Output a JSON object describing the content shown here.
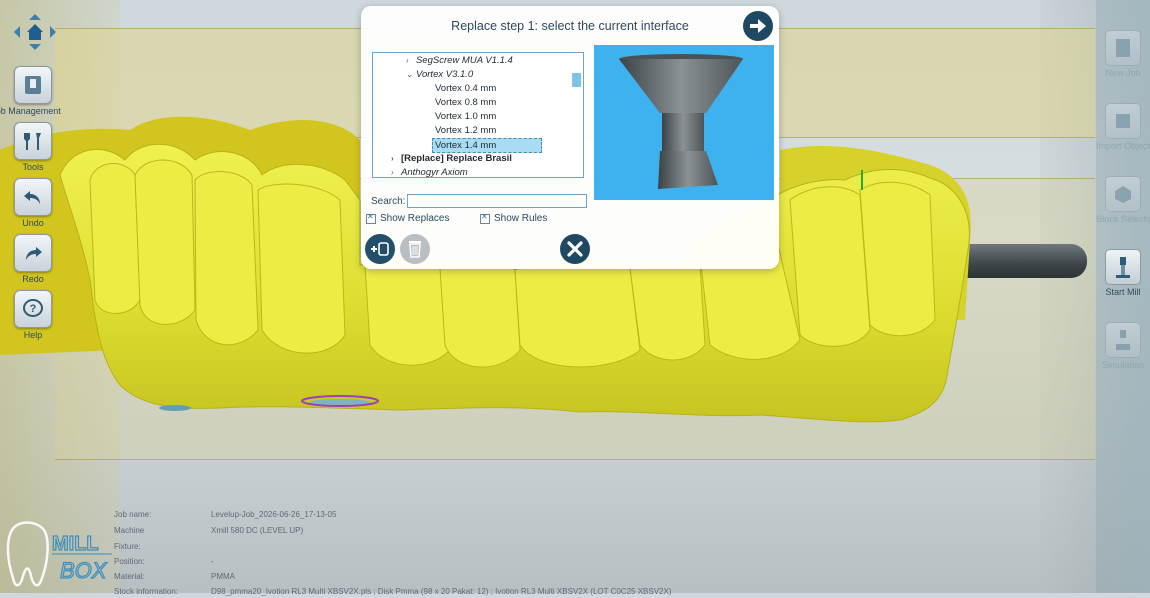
{
  "left_toolbar": {
    "items": [
      {
        "label": "Job Management",
        "icon": "folder-icon"
      },
      {
        "label": "Tools",
        "icon": "wrench-icon"
      },
      {
        "label": "Undo",
        "icon": "undo-icon"
      },
      {
        "label": "Redo",
        "icon": "redo-icon"
      },
      {
        "label": "Help",
        "icon": "help-icon"
      }
    ]
  },
  "right_toolbar": {
    "items": [
      {
        "label": "New Job",
        "icon": "new-job-icon"
      },
      {
        "label": "Import Object",
        "icon": "import-icon"
      },
      {
        "label": "Stock Selection",
        "icon": "stock-icon"
      },
      {
        "label": "Start Mill",
        "icon": "mill-icon"
      },
      {
        "label": "Simulation",
        "icon": "simulation-icon"
      }
    ]
  },
  "dialog": {
    "title": "Replace step 1: select the current interface",
    "tree": [
      {
        "label": "SegScrew MUA V1.1.4"
      },
      {
        "label": "Vortex V3.1.0"
      },
      {
        "label": "Vortex 0.4 mm"
      },
      {
        "label": "Vortex 0.8 mm"
      },
      {
        "label": "Vortex 1.0 mm"
      },
      {
        "label": "Vortex 1.2 mm"
      },
      {
        "label": "Vortex 1.4 mm"
      },
      {
        "label": "[Replace] Replace Brasil"
      },
      {
        "label": "Anthogyr Axiom"
      }
    ],
    "search_label": "Search:",
    "search_value": "",
    "show_replaces": "Show Replaces",
    "show_rules": "Show Rules"
  },
  "job_info": {
    "rows": [
      {
        "key": "Job name:",
        "value": "Levelup-Job_2026-06-26_17-13-05"
      },
      {
        "key": "Machine",
        "value": "Xmill 580 DC (LEVEL UP)"
      },
      {
        "key": "Fixture:",
        "value": ""
      },
      {
        "key": "Position:",
        "value": "-"
      },
      {
        "key": "Material:",
        "value": "PMMA"
      },
      {
        "key": "Stock information:",
        "value": "D98_pmma20_Ivotion RL3 Multi XBSV2X.pls ; Disk Pmma (98 x 20 Pakat: 12) ; Ivotion RL3 Multi XBSV2X (LOT C0C25 XBSV2X)"
      }
    ]
  },
  "logo": {
    "line1": "MILL",
    "line2": "BOX"
  },
  "colors": {
    "accent": "#1f4862",
    "model": "#e2e33a",
    "preview_bg": "#3db2ee",
    "disc": "#ded68c"
  }
}
